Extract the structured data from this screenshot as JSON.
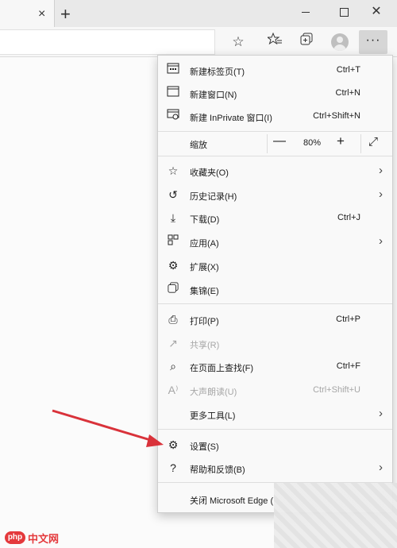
{
  "titlebar": {
    "tab_close": "×",
    "new_tab": "+",
    "close": "✕"
  },
  "toolbar": {
    "more": "···"
  },
  "menu": {
    "items": [
      {
        "label": "新建标签页(T)",
        "shortcut": "Ctrl+T",
        "icon": "new-tab-icon"
      },
      {
        "label": "新建窗口(N)",
        "shortcut": "Ctrl+N",
        "icon": "new-window-icon"
      },
      {
        "label": "新建 InPrivate 窗口(I)",
        "shortcut": "Ctrl+Shift+N",
        "icon": "inprivate-icon"
      },
      {
        "label": "收藏夹(O)",
        "shortcut": "",
        "icon": "favorites-icon"
      },
      {
        "label": "历史记录(H)",
        "shortcut": "",
        "icon": "history-icon"
      },
      {
        "label": "下载(D)",
        "shortcut": "Ctrl+J",
        "icon": "download-icon"
      },
      {
        "label": "应用(A)",
        "shortcut": "",
        "icon": "apps-icon"
      },
      {
        "label": "扩展(X)",
        "shortcut": "",
        "icon": "extensions-icon"
      },
      {
        "label": "集锦(E)",
        "shortcut": "",
        "icon": "collections-icon"
      },
      {
        "label": "打印(P)",
        "shortcut": "Ctrl+P",
        "icon": "print-icon"
      },
      {
        "label": "共享(R)",
        "shortcut": "",
        "icon": "share-icon"
      },
      {
        "label": "在页面上查找(F)",
        "shortcut": "Ctrl+F",
        "icon": "find-icon"
      },
      {
        "label": "大声朗读(U)",
        "shortcut": "Ctrl+Shift+U",
        "icon": "read-aloud-icon"
      },
      {
        "label": "更多工具(L)",
        "shortcut": "",
        "icon": "more-tools-icon"
      },
      {
        "label": "设置(S)",
        "shortcut": "",
        "icon": "settings-icon"
      },
      {
        "label": "帮助和反馈(B)",
        "shortcut": "",
        "icon": "help-icon"
      },
      {
        "label": "关闭 Microsoft Edge (",
        "shortcut": "",
        "icon": ""
      }
    ],
    "zoom": {
      "label": "缩放",
      "minus": "—",
      "value": "80%",
      "plus": "+"
    }
  },
  "watermark": {
    "php": "php",
    "site": "中文网"
  },
  "colors": {
    "annotation_arrow": "#d9323a",
    "menu_bg": "#f9f9f9"
  }
}
